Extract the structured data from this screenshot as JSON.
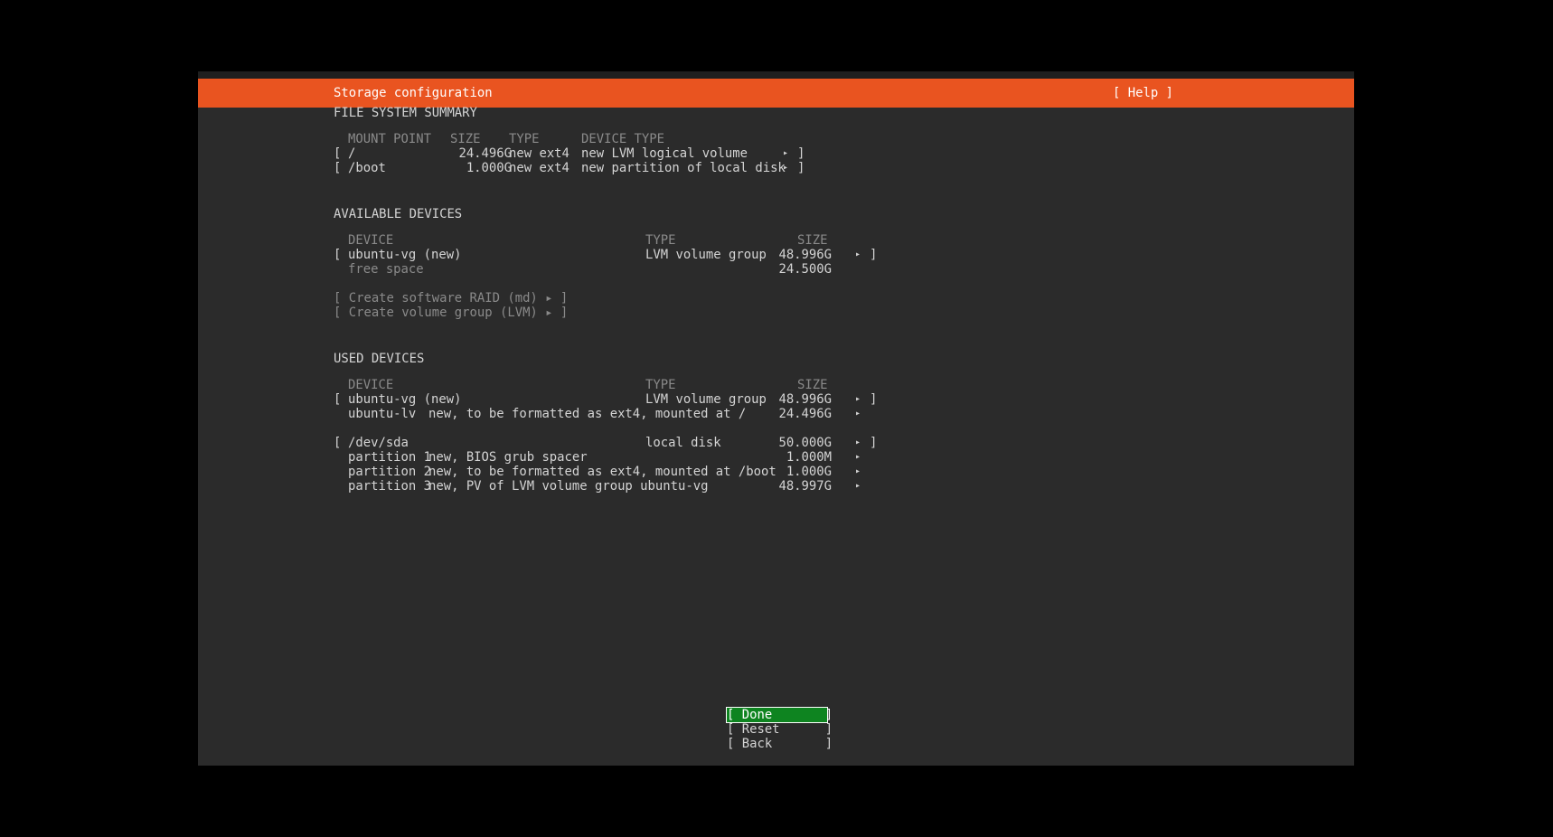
{
  "header": {
    "title": "Storage configuration",
    "help_label": "[ Help ]"
  },
  "fs_summary": {
    "heading": "FILE SYSTEM SUMMARY",
    "columns": {
      "mount": "MOUNT POINT",
      "size": "SIZE",
      "type": "TYPE",
      "device_type": "DEVICE TYPE"
    },
    "rows": [
      {
        "mount": "/",
        "size": "24.496G",
        "type": "new ext4",
        "device_type": "new LVM logical volume"
      },
      {
        "mount": "/boot",
        "size": "1.000G",
        "type": "new ext4",
        "device_type": "new partition of local disk"
      }
    ]
  },
  "available": {
    "heading": "AVAILABLE DEVICES",
    "columns": {
      "device": "DEVICE",
      "type": "TYPE",
      "size": "SIZE"
    },
    "rows": [
      {
        "device": "ubuntu-vg (new)",
        "type": "LVM volume group",
        "size": "48.996G"
      },
      {
        "device": "free space",
        "size": "24.500G"
      }
    ],
    "actions": [
      "[ Create software RAID (md) ▸ ]",
      "[ Create volume group (LVM) ▸ ]"
    ]
  },
  "used": {
    "heading": "USED DEVICES",
    "columns": {
      "device": "DEVICE",
      "type": "TYPE",
      "size": "SIZE"
    },
    "groups": [
      {
        "device": "ubuntu-vg (new)",
        "type": "LVM volume group",
        "size": "48.996G",
        "children": [
          {
            "name": "ubuntu-lv",
            "desc": "new, to be formatted as ext4, mounted at /",
            "size": "24.496G"
          }
        ]
      },
      {
        "device": "/dev/sda",
        "type": "local disk",
        "size": "50.000G",
        "children": [
          {
            "name": "partition 1",
            "desc": "new, BIOS grub spacer",
            "size": "1.000M"
          },
          {
            "name": "partition 2",
            "desc": "new, to be formatted as ext4, mounted at /boot",
            "size": "1.000G"
          },
          {
            "name": "partition 3",
            "desc": "new, PV of LVM volume group ubuntu-vg",
            "size": "48.997G"
          }
        ]
      }
    ]
  },
  "buttons": {
    "done": "[ Done       ]",
    "reset": "[ Reset      ]",
    "back": "[ Back       ]"
  },
  "glyphs": {
    "open_bracket": "[",
    "close_bracket": "]",
    "arrow": "▸"
  },
  "colors": {
    "header": "#e95420",
    "selected_button": "#0e8420",
    "background": "#2b2b2b"
  }
}
